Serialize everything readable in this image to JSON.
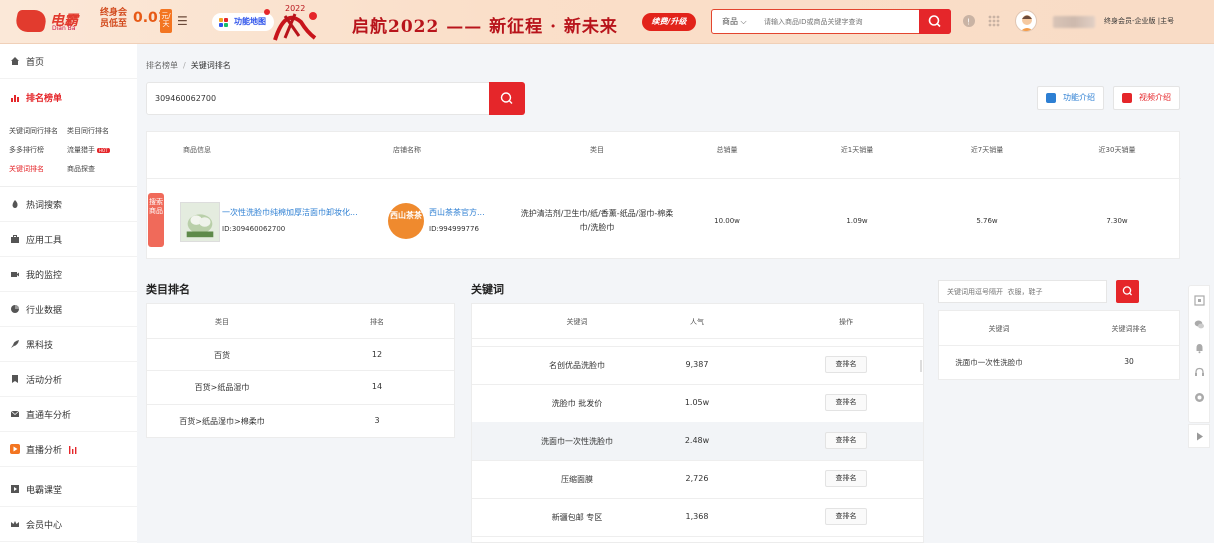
{
  "header": {
    "logo_text": "电霸",
    "logo_sub": "Dian Ba",
    "lifetime_label": "终身会员低至",
    "price": "0.01",
    "yuan_badge": "元/天",
    "feature_map": "功能地图",
    "slogan": "启航2022 —— 新征程 · 新未来",
    "upgrade": "续费/升级",
    "search_category": "商品",
    "search_placeholder": "请输入商品ID或商品关键字查询",
    "member_text": "终身会员-企业版 |主号",
    "deco_year": "2022"
  },
  "colors": {
    "accent": "#e5262a",
    "link": "#2d7fd3",
    "tag": "#f06a5a",
    "shop": "#ef8a2e"
  },
  "sidebar": {
    "items": [
      {
        "label": "首页",
        "icon": "home-icon"
      },
      {
        "label": "排名榜单",
        "icon": "bar-chart-icon"
      },
      {
        "label": "热词搜索",
        "icon": "flame-icon"
      },
      {
        "label": "应用工具",
        "icon": "toolbox-icon"
      },
      {
        "label": "我的监控",
        "icon": "camera-icon"
      },
      {
        "label": "行业数据",
        "icon": "pie-icon"
      },
      {
        "label": "黑科技",
        "icon": "rocket-icon"
      },
      {
        "label": "活动分析",
        "icon": "ticket-icon"
      },
      {
        "label": "直通车分析",
        "icon": "mail-icon"
      },
      {
        "label": "直播分析",
        "icon": "live-icon"
      },
      {
        "label": "电霸课堂",
        "icon": "play-icon"
      },
      {
        "label": "会员中心",
        "icon": "crown-icon"
      }
    ],
    "subnav": {
      "kw_peer": "关键词同行排名",
      "cat_peer": "类目同行排名",
      "multi": "多多排行榜",
      "flow": "流量猎手",
      "hot": "HOT",
      "kw_rank": "关键词排名",
      "probe": "商品探查"
    }
  },
  "breadcrumb": {
    "root": "排名榜单",
    "sep": "/",
    "current": "关键词排名"
  },
  "main_search": {
    "value": "309460062700"
  },
  "intro_buttons": {
    "feature": "功能介绍",
    "video": "视频介绍"
  },
  "product_table": {
    "headers": [
      "商品信息",
      "店铺名称",
      "类目",
      "总销量",
      "近1天销量",
      "近7天销量",
      "近30天销量"
    ],
    "row": {
      "tag": "搜索商品",
      "name": "一次性洗脸巾纯棉加厚洁面巾卸妆化...",
      "id": "ID:309460062700",
      "shop_logo": "西山茶茶",
      "shop_name": "西山茶茶官方...",
      "shop_id": "ID:994999776",
      "category": "洗护清洁剂/卫生巾/纸/香薰-纸品/湿巾-棉柔巾/洗脸巾",
      "total": "10.00w",
      "d1": "1.09w",
      "d7": "5.76w",
      "d30": "7.30w"
    }
  },
  "category_rank": {
    "title": "类目排名",
    "headers": [
      "类目",
      "排名"
    ],
    "rows": [
      {
        "cat": "百货",
        "rank": "12"
      },
      {
        "cat": "百货>纸品湿巾",
        "rank": "14"
      },
      {
        "cat": "百货>纸品湿巾>棉柔巾",
        "rank": "3"
      }
    ]
  },
  "keywords": {
    "title": "关键词",
    "headers": [
      "关键词",
      "人气",
      "操作"
    ],
    "btn": "查排名",
    "rows": [
      {
        "kw": "名创优品洗脸巾",
        "pop": "9,387"
      },
      {
        "kw": "洗脸巾 批发价",
        "pop": "1.05w"
      },
      {
        "kw": "洗面巾一次性洗脸巾",
        "pop": "2.48w"
      },
      {
        "kw": "压缩面膜",
        "pop": "2,726"
      },
      {
        "kw": "新疆包邮 专区",
        "pop": "1,368"
      }
    ]
  },
  "kw_rank_panel": {
    "placeholder": "关键词用逗号隔开  衣服，鞋子",
    "headers": [
      "关键词",
      "关键词排名"
    ],
    "rows": [
      {
        "kw": "洗面巾一次性洗脸巾",
        "rank": "30"
      }
    ]
  }
}
